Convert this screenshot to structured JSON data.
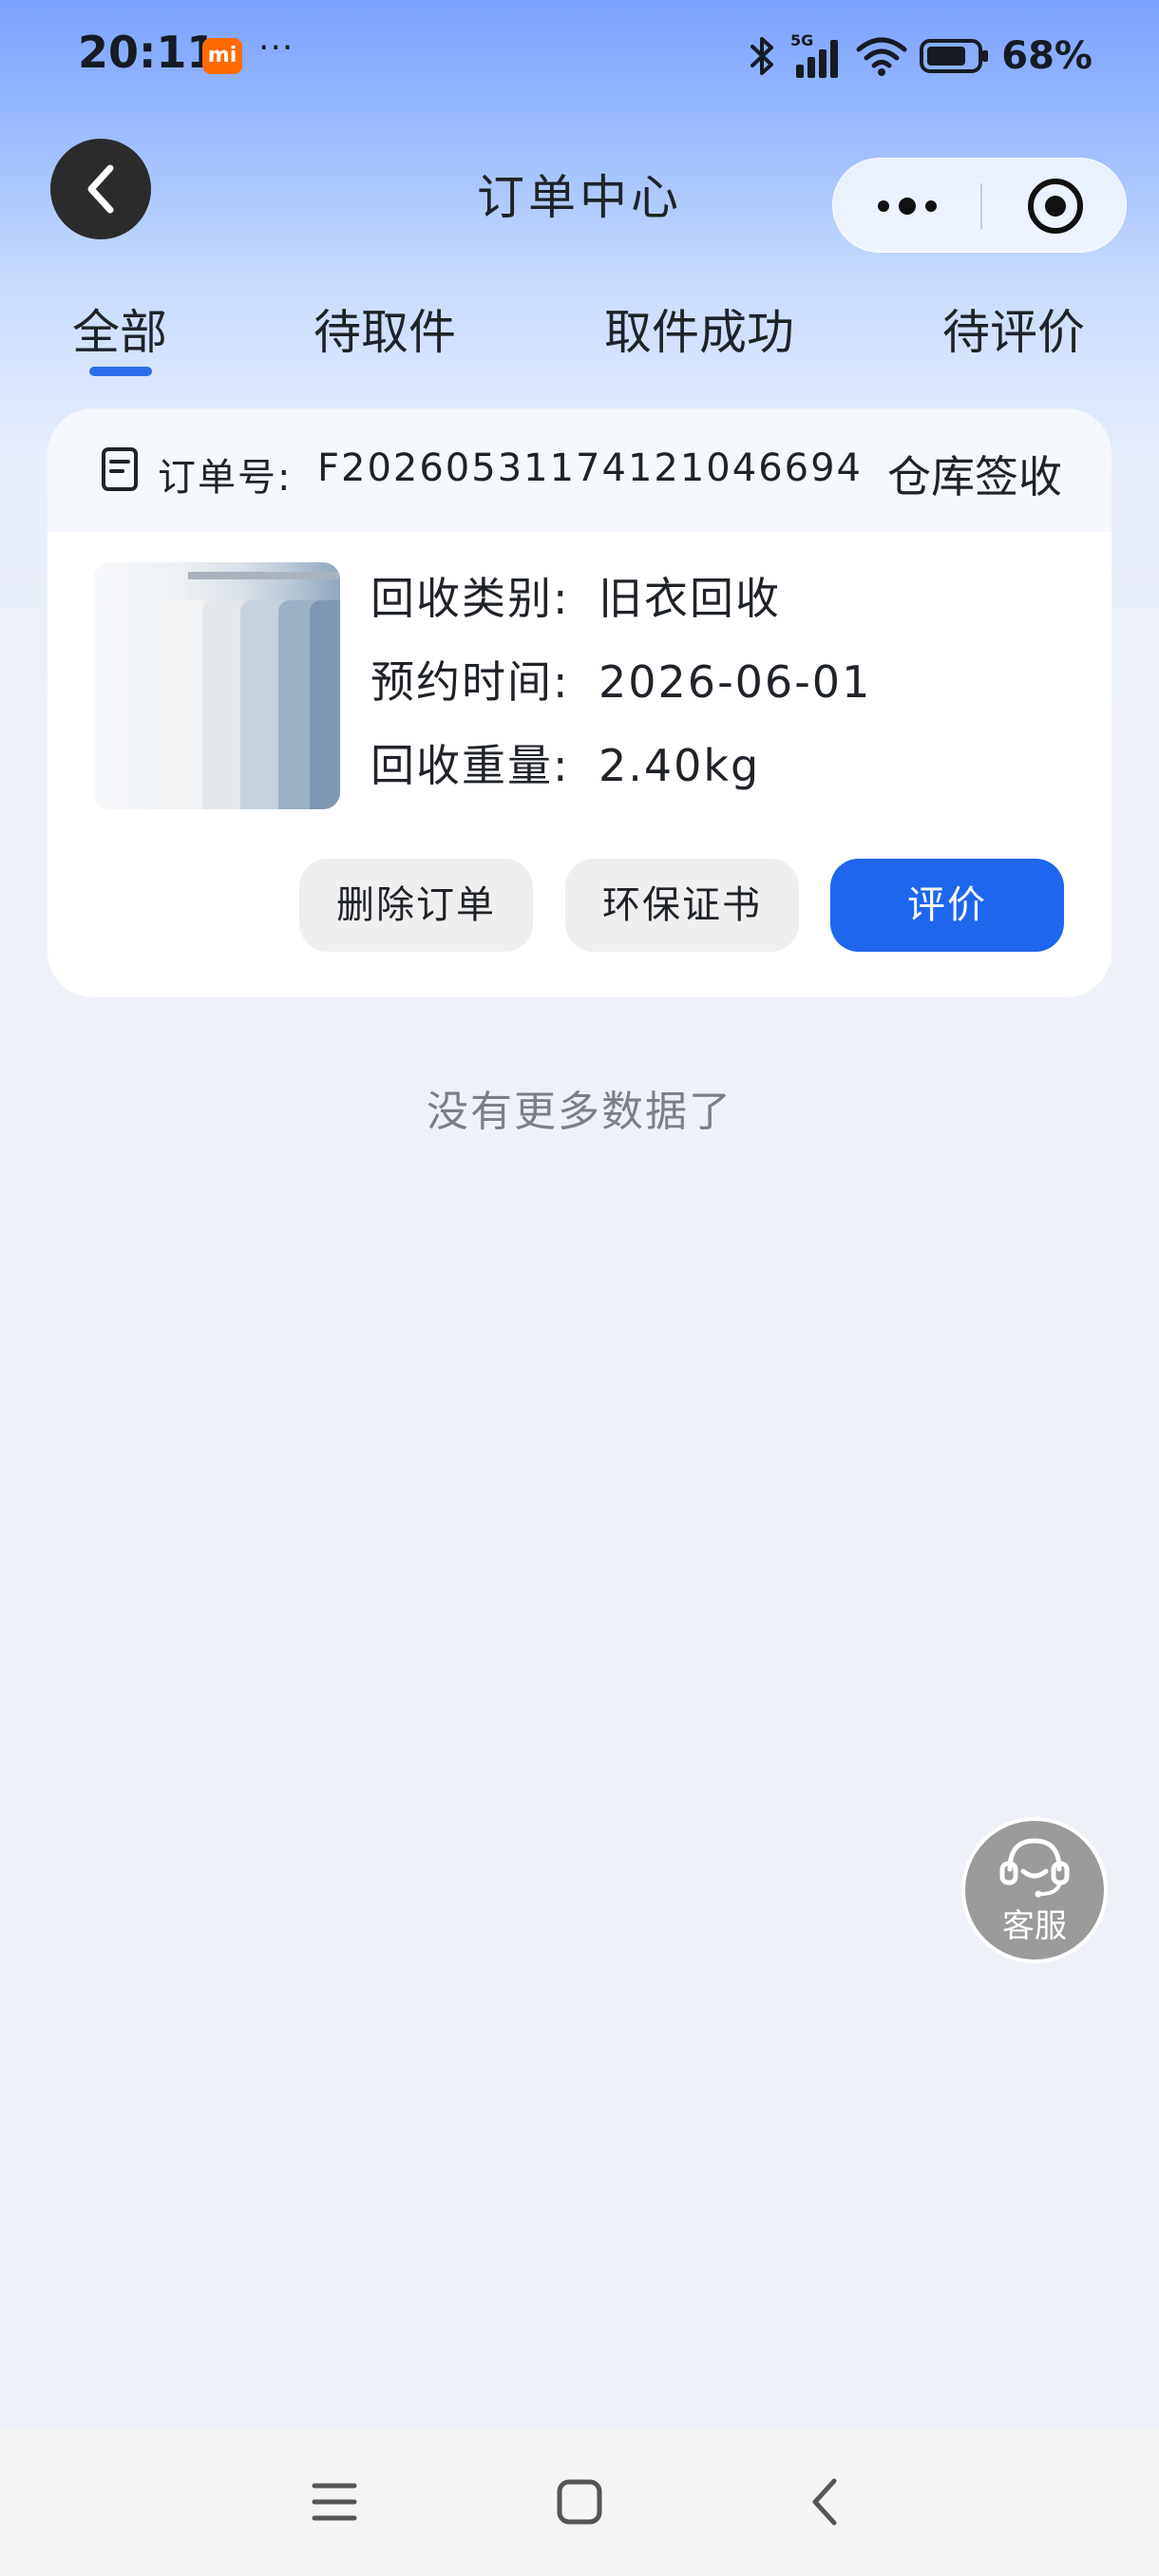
{
  "status_bar": {
    "time": "20:11",
    "badge": "mi",
    "more_dots": "···",
    "network": "5G",
    "battery_percent": "68%",
    "icons": [
      "bluetooth-icon",
      "signal-icon",
      "wifi-icon",
      "battery-icon"
    ]
  },
  "nav": {
    "title": "订单中心",
    "back_icon": "chevron-left-icon",
    "more_icon": "more-dots-icon",
    "close_icon": "target-close-icon"
  },
  "tabs": [
    {
      "label": "全部",
      "active": true
    },
    {
      "label": "待取件",
      "active": false
    },
    {
      "label": "取件成功",
      "active": false
    },
    {
      "label": "待评价",
      "active": false
    }
  ],
  "order": {
    "order_no_label": "订单号:",
    "order_no": "F20260531174121046694",
    "status": "仓库签收",
    "rows": [
      {
        "label": "回收类别:",
        "value": "旧衣回收"
      },
      {
        "label": "预约时间:",
        "value": "2026-06-01"
      },
      {
        "label": "回收重量:",
        "value": "2.40kg"
      }
    ],
    "buttons": {
      "delete": "删除订单",
      "certificate": "环保证书",
      "review": "评价"
    }
  },
  "footer_text": "没有更多数据了",
  "customer_service": {
    "label": "客服",
    "icon": "headset-icon"
  },
  "colors": {
    "accent": "#1f66ee",
    "tab_indicator": "#2b6de8",
    "header_gradient_top": "#7aa3ff",
    "background": "#eef2f8"
  }
}
